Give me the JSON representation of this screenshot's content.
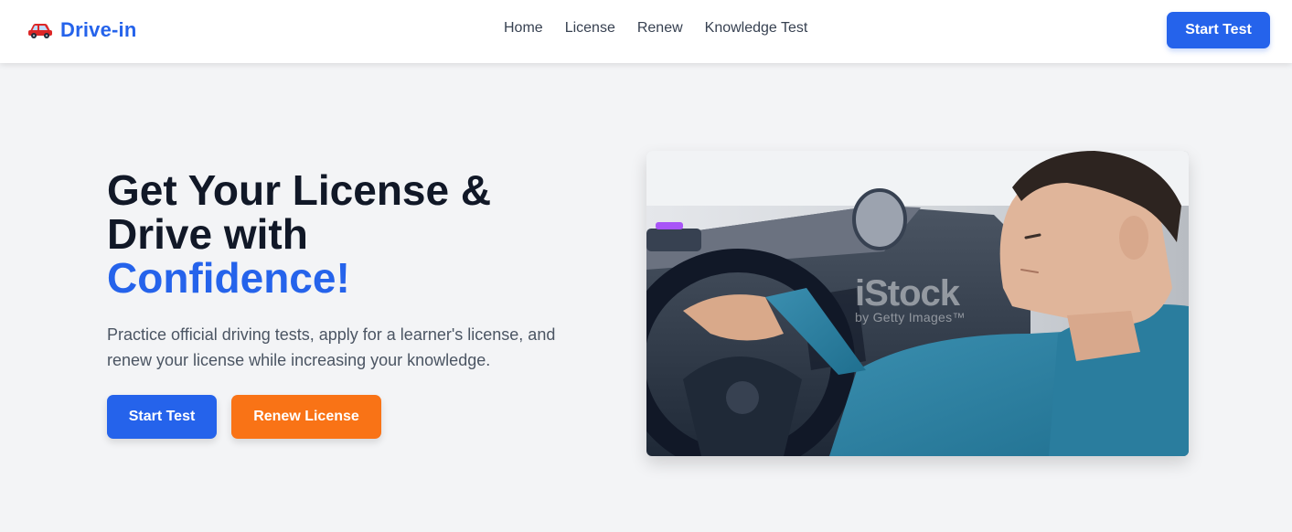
{
  "brand": {
    "name": "Drive-in",
    "logo_icon": "car-icon"
  },
  "nav": {
    "links": [
      "Home",
      "License",
      "Renew",
      "Knowledge Test"
    ],
    "cta": "Start Test"
  },
  "hero": {
    "title_line1": "Get Your License &",
    "title_line2": "Drive with",
    "title_accent": "Confidence!",
    "subtitle": "Practice official driving tests, apply for a learner's license, and renew your license while increasing your knowledge.",
    "primary_button": "Start Test",
    "secondary_button": "Renew License",
    "image": {
      "watermark_main": "iStock",
      "watermark_sub": "by Getty Images™"
    }
  },
  "colors": {
    "accent": "#2563eb",
    "secondary": "#f97316",
    "background": "#f3f4f6",
    "heading": "#111827"
  }
}
